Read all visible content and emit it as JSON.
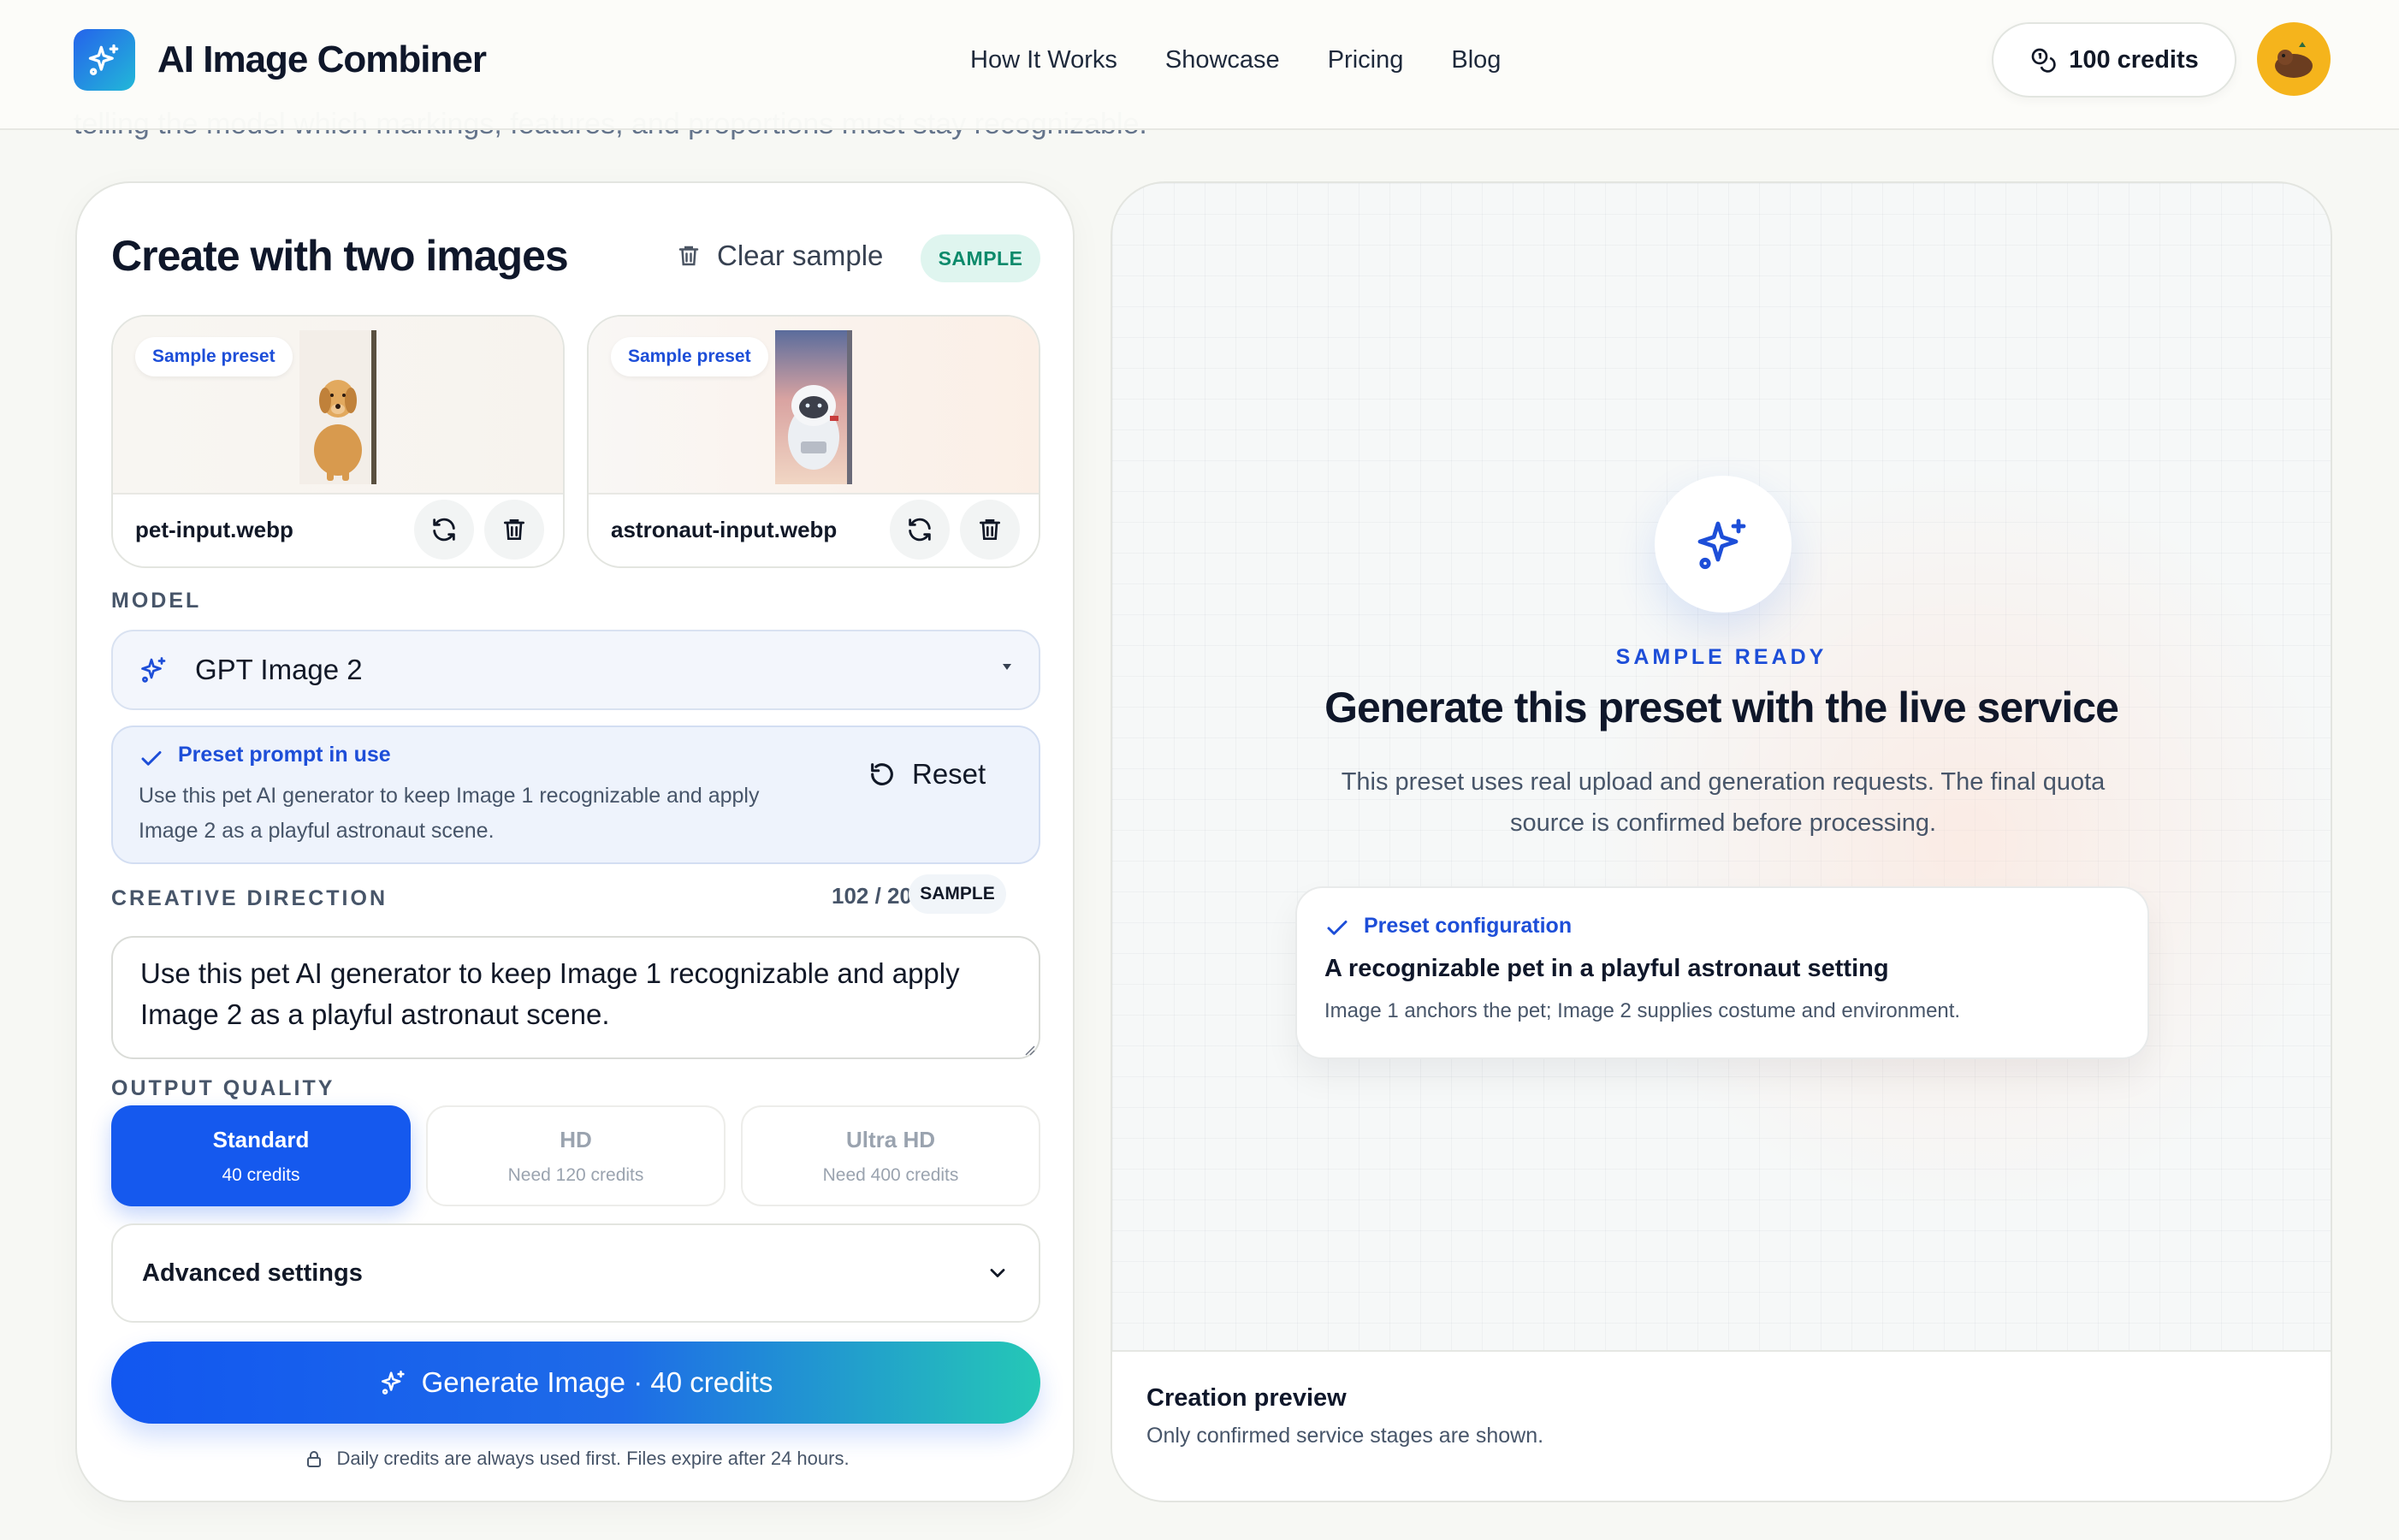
{
  "header": {
    "brand": "AI Image Combiner",
    "nav": [
      "How It Works",
      "Showcase",
      "Pricing",
      "Blog"
    ],
    "credits": "100 credits",
    "cut_off_text": "telling the model which markings, features, and proportions must stay recognizable."
  },
  "form": {
    "title": "Create with two images",
    "clear_sample": "Clear sample",
    "sample_badge": "SAMPLE",
    "uploads": [
      {
        "tag": "Sample preset",
        "filename": "pet-input.webp"
      },
      {
        "tag": "Sample preset",
        "filename": "astronaut-input.webp"
      }
    ],
    "model_label": "MODEL",
    "model_value": "GPT Image 2",
    "preset": {
      "title": "Preset prompt in use",
      "body": "Use this pet AI generator to keep Image 1 recognizable and apply Image 2 as a playful astronaut scene.",
      "reset": "Reset"
    },
    "creative_label": "CREATIVE DIRECTION",
    "counter": "102 / 200",
    "counter_badge": "SAMPLE",
    "prompt_text": "Use this pet AI generator to keep Image 1 recognizable and apply Image 2 as a playful astronaut scene.",
    "quality_label": "OUTPUT QUALITY",
    "quality_options": [
      {
        "name": "Standard",
        "sub": "40 credits",
        "active": true
      },
      {
        "name": "HD",
        "sub": "Need 120 credits",
        "active": false
      },
      {
        "name": "Ultra HD",
        "sub": "Need 400 credits",
        "active": false
      }
    ],
    "advanced": "Advanced settings",
    "generate": "Generate Image · 40 credits",
    "footnote": "Daily credits are always used first. Files expire after 24 hours."
  },
  "preview": {
    "ready_label": "SAMPLE READY",
    "title": "Generate this preset with the live service",
    "description": "This preset uses real upload and generation requests. The final quota source is confirmed before processing.",
    "config": {
      "label": "Preset configuration",
      "title": "A recognizable pet in a playful astronaut setting",
      "desc": "Image 1 anchors the pet; Image 2 supplies costume and environment."
    },
    "footer_title": "Creation preview",
    "footer_sub": "Only confirmed service stages are shown."
  },
  "colors": {
    "accent": "#1559ee",
    "teal": "#25c8b6",
    "sample_badge": "#0c8a6b"
  }
}
